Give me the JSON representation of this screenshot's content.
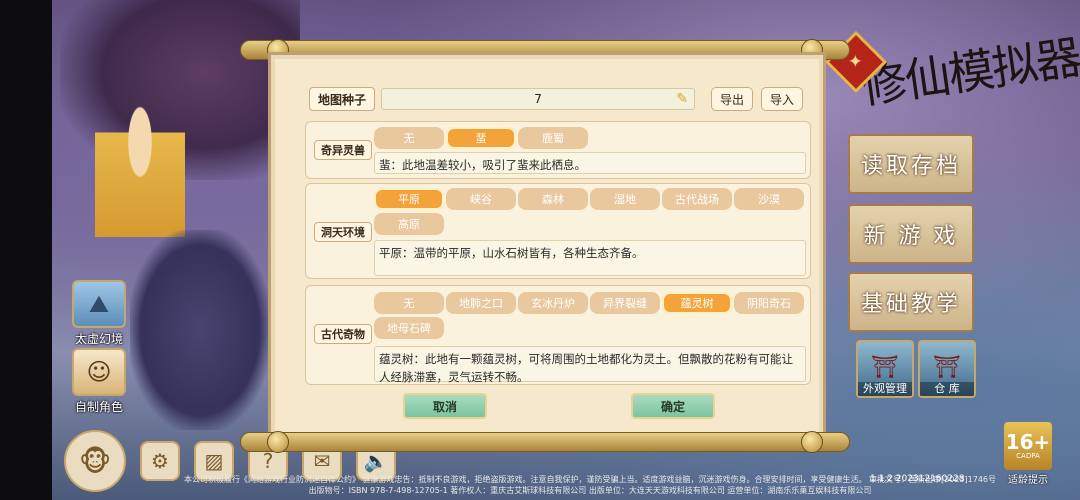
{
  "game_title": "修仙模拟器",
  "sidebar": {
    "items": [
      {
        "label": "太虚幻境"
      },
      {
        "label": "自制角色"
      }
    ]
  },
  "menu": {
    "load_label": "读取存档",
    "new_label": "新 游 戏",
    "tutorial_label": "基础教学",
    "appearance_label": "外观管理",
    "warehouse_label": "仓 库"
  },
  "dialog": {
    "seed": {
      "label": "地图种子",
      "value": "7",
      "export_label": "导出",
      "import_label": "导入"
    },
    "sections": [
      {
        "label": "奇异灵兽",
        "options": [
          "无",
          "蜚",
          "鹿蜀"
        ],
        "selected": 1,
        "description": "蜚：此地温差较小，吸引了蜚来此栖息。"
      },
      {
        "label": "洞天环境",
        "options": [
          "平原",
          "峡谷",
          "森林",
          "湿地",
          "古代战场",
          "沙漠",
          "高原"
        ],
        "selected": 0,
        "description": "平原：温带的平原，山水石树皆有，各种生态齐备。"
      },
      {
        "label": "古代奇物",
        "options": [
          "无",
          "地肺之口",
          "玄冰丹炉",
          "异界裂缝",
          "蕴灵树",
          "阴阳奇石",
          "地母石碑"
        ],
        "selected": 4,
        "description": "蕴灵树：此地有一颗蕴灵树，可将周围的土地都化为灵土。但飘散的花粉有可能让人经脉滞塞，灵气运转不畅。"
      }
    ],
    "cancel_label": "取消",
    "confirm_label": "确定"
  },
  "footer": {
    "notice": "本公司积极履行《网络游戏行业防沉迷自律公约》 健康游戏忠告：抵制不良游戏，拒绝盗版游戏。注意自我保护，谨防受骗上当。适度游戏益脑，沉迷游戏伤身。合理安排时间，享受健康生活。 审批文号：国新出审[2023]1746号 出版物号：ISBN 978-7-498-12705-1 著作权人：重庆古艾斯球科技有限公司 出版单位：大连天天游戏科技有限公司 运营单位：湖南乐乐菓互娱科技有限公司",
    "version": "1.1.2 202312160228"
  },
  "age_rating": {
    "rating": "16+",
    "org": "CADPA",
    "tip": "适龄提示"
  },
  "colors": {
    "accent": "#f4a23a",
    "chip": "#e9c89e",
    "panel": "#f5e8cc",
    "confirm": "#7cc4a0"
  }
}
